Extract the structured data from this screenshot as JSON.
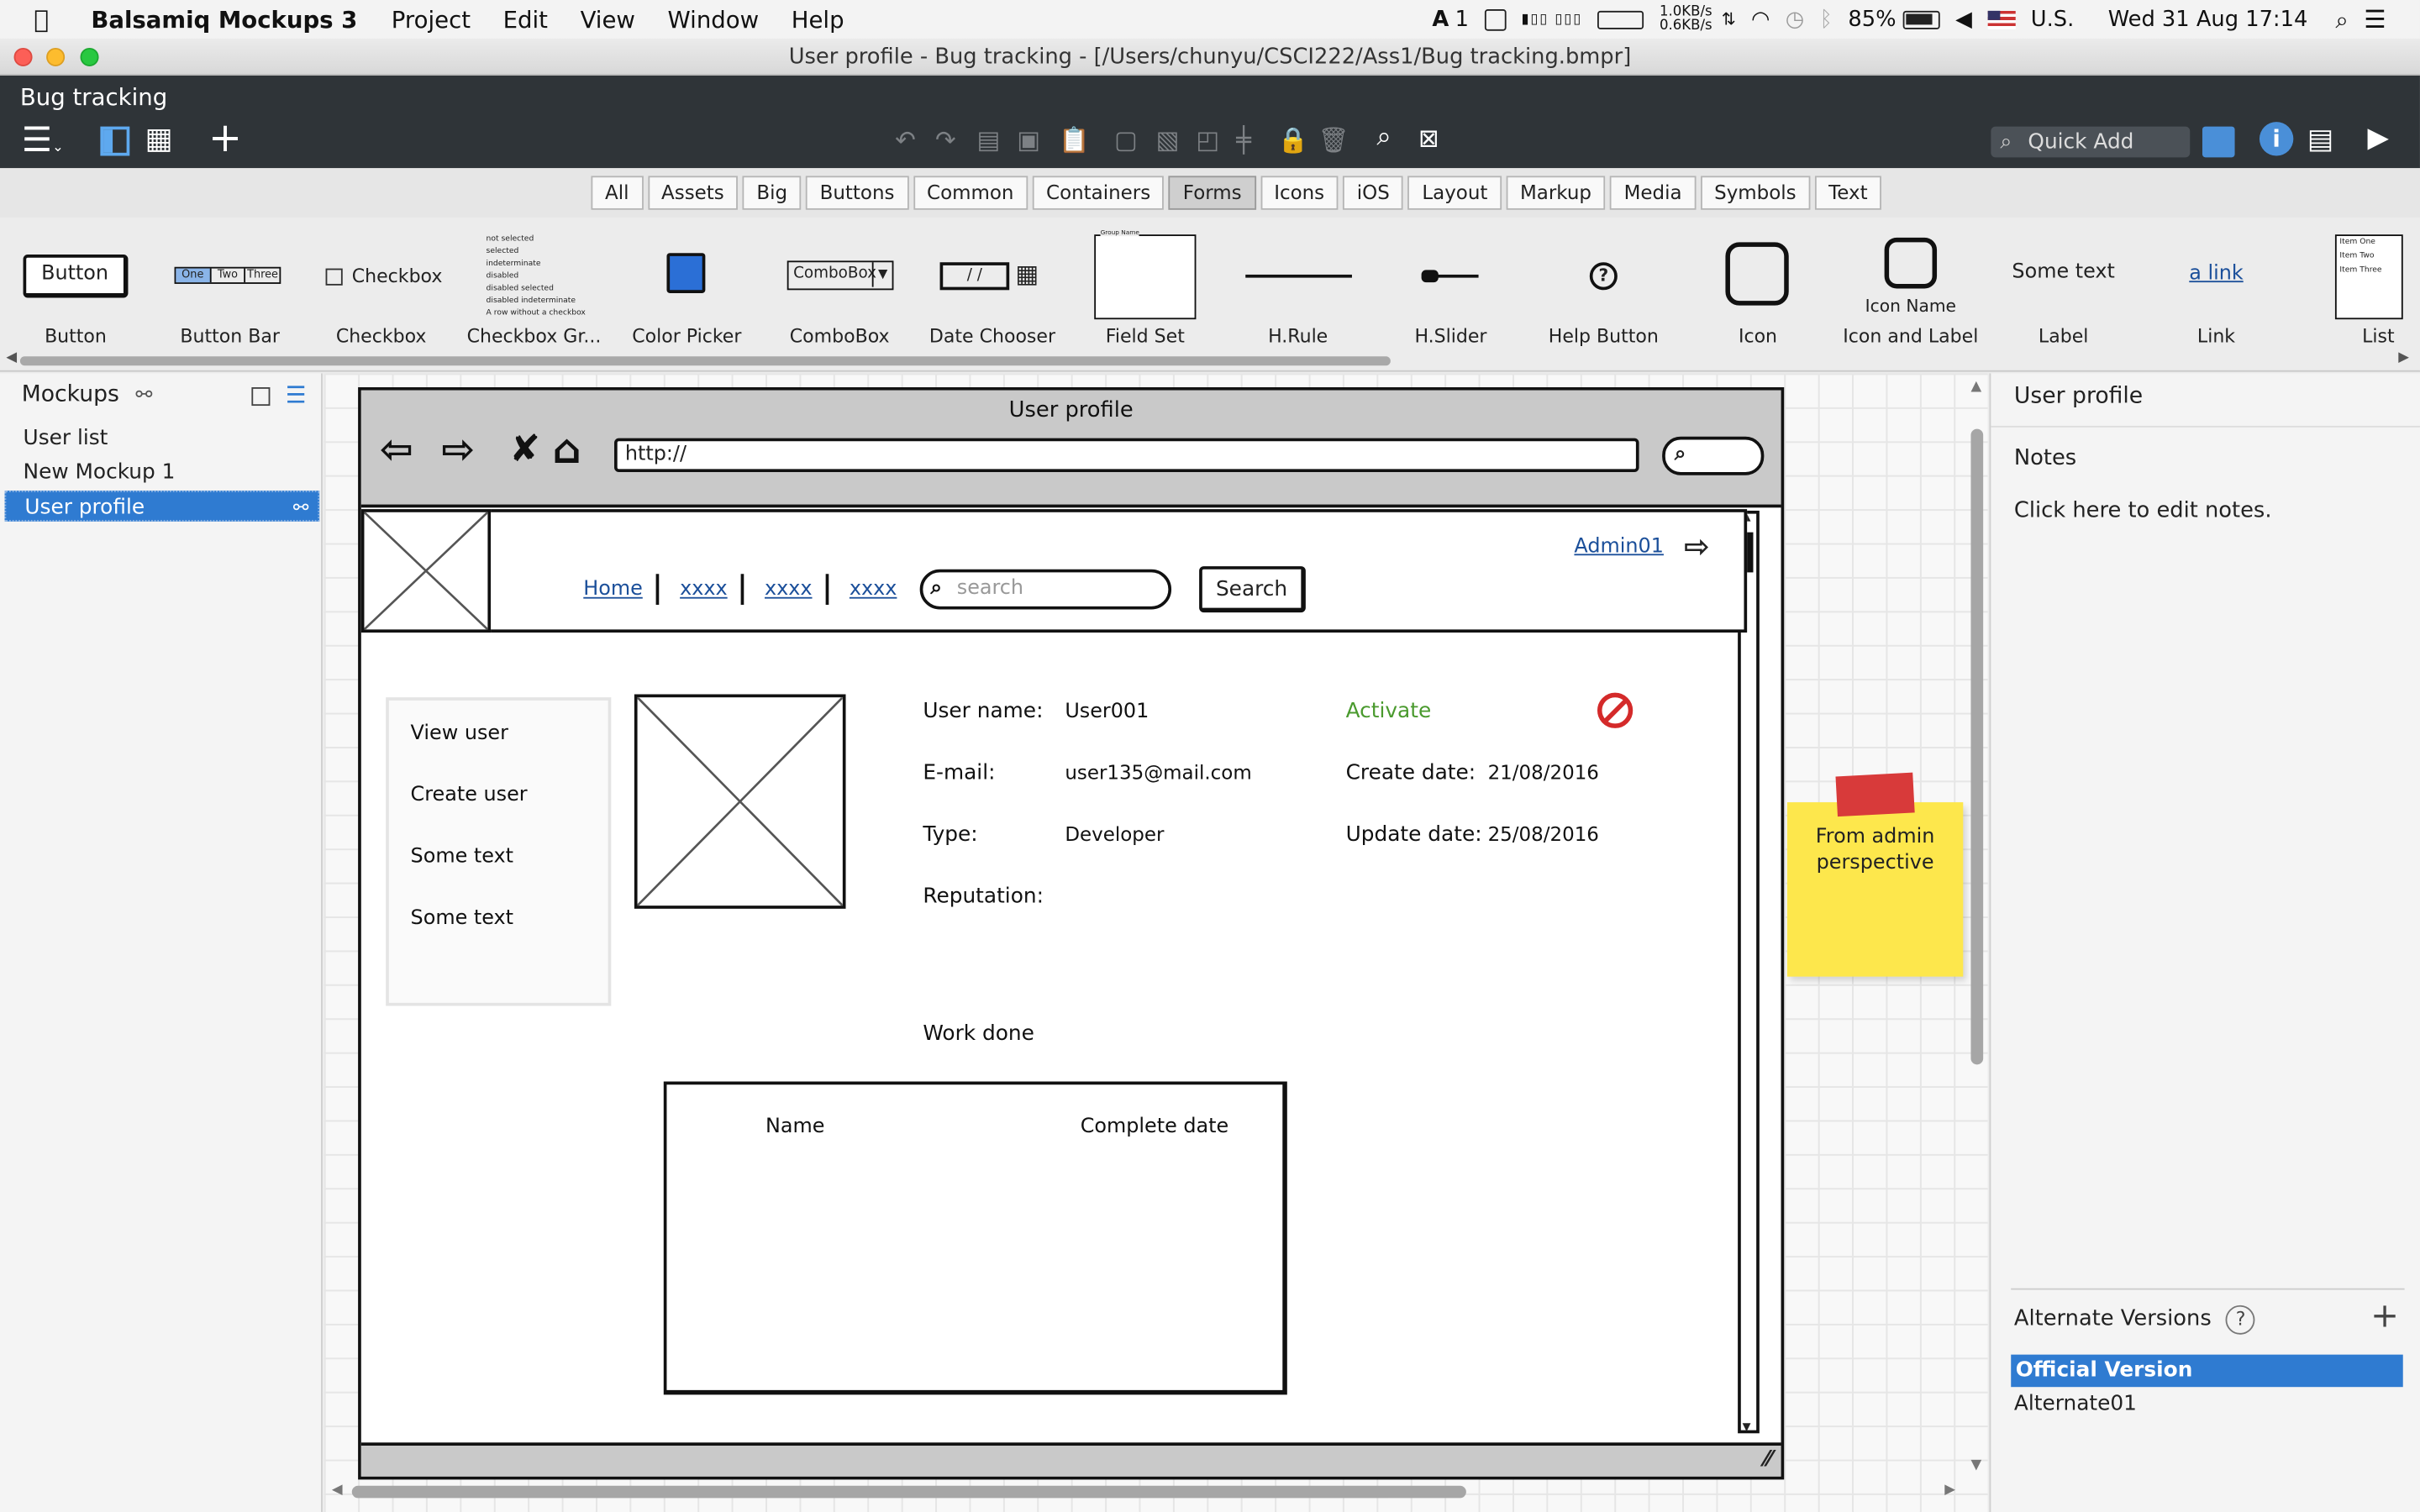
{
  "menubar": {
    "app_name": "Balsamiq Mockups 3",
    "items": [
      "Project",
      "Edit",
      "View",
      "Window",
      "Help"
    ],
    "status": {
      "net_up": "1.0KB/s",
      "net_down": "0.6KB/s",
      "battery": "85%",
      "input_source": "U.S.",
      "datetime": "Wed 31 Aug  17:14",
      "adobe_count": "1"
    }
  },
  "window": {
    "title": "User profile - Bug tracking - [/Users/chunyu/CSCI222/Ass1/Bug tracking.bmpr]",
    "project_name": "Bug tracking"
  },
  "toolbar": {
    "quick_add_placeholder": "Quick Add"
  },
  "filter_tabs": [
    {
      "label": "All"
    },
    {
      "label": "Assets"
    },
    {
      "label": "Big"
    },
    {
      "label": "Buttons"
    },
    {
      "label": "Common"
    },
    {
      "label": "Containers"
    },
    {
      "label": "Forms",
      "active": true
    },
    {
      "label": "Icons"
    },
    {
      "label": "iOS"
    },
    {
      "label": "Layout"
    },
    {
      "label": "Markup"
    },
    {
      "label": "Media"
    },
    {
      "label": "Symbols"
    },
    {
      "label": "Text"
    }
  ],
  "library": {
    "button": {
      "label": "Button",
      "preview": "Button"
    },
    "button_bar": {
      "label": "Button Bar",
      "preview": [
        "One",
        "Two",
        "Three"
      ]
    },
    "checkbox": {
      "label": "Checkbox",
      "preview": "Checkbox"
    },
    "checkbox_group": {
      "label": "Checkbox Gr...",
      "preview": [
        "not selected",
        "selected",
        "indeterminate",
        "disabled",
        "disabled selected",
        "disabled indeterminate",
        "A row without a checkbox"
      ]
    },
    "color_picker": {
      "label": "Color Picker",
      "color": "#2b6fd6"
    },
    "combobox": {
      "label": "ComboBox",
      "preview": "ComboBox"
    },
    "date_chooser": {
      "label": "Date Chooser",
      "preview": "/  /"
    },
    "field_set": {
      "label": "Field Set",
      "preview": "Group Name"
    },
    "hrule": {
      "label": "H.Rule"
    },
    "hslider": {
      "label": "H.Slider"
    },
    "help_button": {
      "label": "Help Button",
      "preview": "?"
    },
    "icon": {
      "label": "Icon"
    },
    "icon_label": {
      "label": "Icon and Label",
      "preview": "Icon Name"
    },
    "label": {
      "label": "Label",
      "preview": "Some text"
    },
    "link": {
      "label": "Link",
      "preview": "a link"
    },
    "list": {
      "label": "List",
      "preview": [
        "Item One",
        "Item Two",
        "Item Three"
      ]
    }
  },
  "mockups_panel": {
    "title": "Mockups",
    "items": [
      {
        "label": "User list"
      },
      {
        "label": "New Mockup 1"
      },
      {
        "label": "User profile",
        "selected": true
      }
    ]
  },
  "mockup": {
    "browser_title": "User profile",
    "url": "http://",
    "header": {
      "admin_link": "Admin01",
      "nav_links": [
        "Home",
        "xxxx",
        "xxxx",
        "xxxx"
      ],
      "search_placeholder": "search",
      "search_button": "Search"
    },
    "side_menu": [
      "View user",
      "Create user",
      "Some text",
      "Some text"
    ],
    "profile": {
      "username_label": "User name:",
      "username_value": "User001",
      "email_label": "E-mail:",
      "email_value": "user135@mail.com",
      "type_label": "Type:",
      "type_value": "Developer",
      "reputation_label": "Reputation:",
      "activate_label": "Activate",
      "activate_color": "#4a9a2e",
      "create_date_label": "Create date:",
      "create_date_value": "21/08/2016",
      "update_date_label": "Update date:",
      "update_date_value": "25/08/2016"
    },
    "work_done": {
      "title": "Work done",
      "columns": [
        "Name",
        "Complete date"
      ]
    },
    "sticky_note": "From admin perspective"
  },
  "right_panel": {
    "title": "User profile",
    "notes_label": "Notes",
    "notes_placeholder": "Click here to edit notes.",
    "alt_versions_title": "Alternate Versions",
    "versions": [
      {
        "label": "Official Version",
        "selected": true
      },
      {
        "label": "Alternate01"
      }
    ]
  },
  "colors": {
    "accent": "#2f7bd1",
    "dark_toolbar": "#2f3438",
    "link": "#1b4f9a",
    "sticky": "#fde74c",
    "sticky_tape": "#d83a3a",
    "stop_icon": "#d42a2a"
  }
}
